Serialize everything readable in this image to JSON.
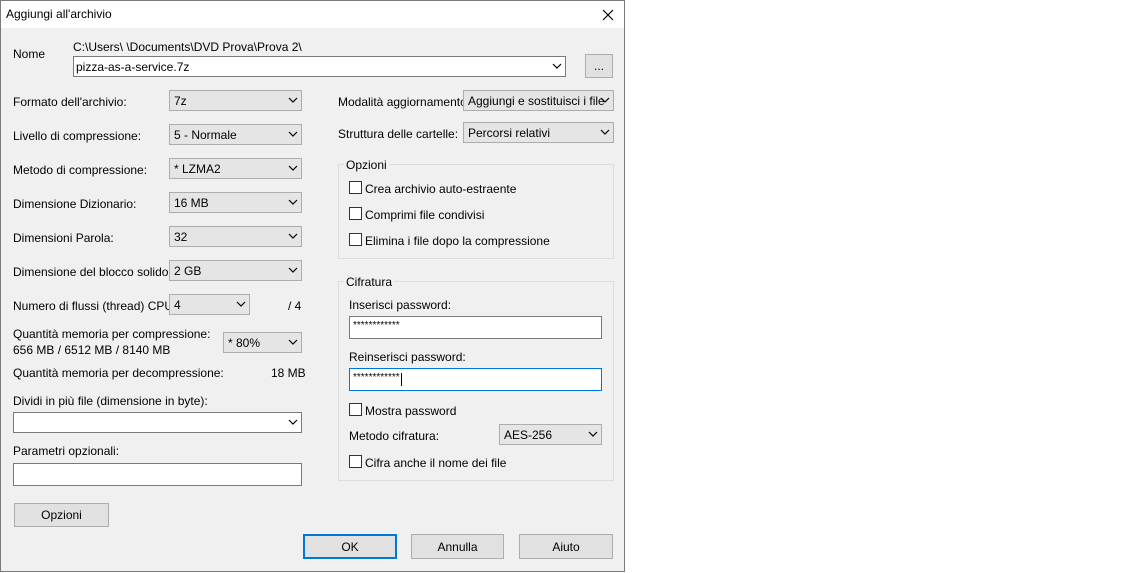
{
  "window": {
    "title": "Aggiungi all'archivio"
  },
  "name": {
    "label": "Nome",
    "path": "C:\\Users\\          \\Documents\\DVD Prova\\Prova 2\\",
    "value": "pizza-as-a-service.7z",
    "browse_label": "..."
  },
  "left": {
    "format_label": "Formato dell'archivio:",
    "format_value": "7z",
    "level_label": "Livello di compressione:",
    "level_value": "5 - Normale",
    "method_label": "Metodo di compressione:",
    "method_value": "*  LZMA2",
    "dict_label": "Dimensione Dizionario:",
    "dict_value": "16 MB",
    "word_label": "Dimensioni Parola:",
    "word_value": "32",
    "solid_label": "Dimensione del blocco solido:",
    "solid_value": "2 GB",
    "threads_label": "Numero di flussi (thread) CPU:",
    "threads_value": "4",
    "threads_max": "/ 4",
    "mem_comp_label": "Quantità memoria per compressione:",
    "mem_comp_detail": "656 MB / 6512 MB / 8140 MB",
    "mem_comp_value": "*  80%",
    "mem_decomp_label": "Quantità memoria per decompressione:",
    "mem_decomp_value": "18 MB",
    "split_label": "Dividi in più file (dimensione in byte):",
    "split_value": "",
    "params_label": "Parametri opzionali:",
    "params_value": "",
    "options_button": "Opzioni"
  },
  "right": {
    "update_label": "Modalità aggiornamento:",
    "update_value": "Aggiungi e sostituisci i file",
    "paths_label": "Struttura delle cartelle:",
    "paths_value": "Percorsi relativi",
    "options_group": "Opzioni",
    "sfx_label": "Crea archivio auto-estraente",
    "shared_label": "Comprimi file condivisi",
    "delete_label": "Elimina i file dopo la compressione",
    "encryption_group": "Cifratura",
    "password_label": "Inserisci password:",
    "password_value": "************",
    "repassword_label": "Reinserisci password:",
    "repassword_value": "************",
    "show_password_label": "Mostra password",
    "enc_method_label": "Metodo cifratura:",
    "enc_method_value": "AES-256",
    "encrypt_names_label": "Cifra anche il nome dei file"
  },
  "buttons": {
    "ok": "OK",
    "cancel": "Annulla",
    "help": "Aiuto"
  },
  "icons": {
    "close": "close-icon",
    "dropdown": "chevron-down-icon"
  }
}
